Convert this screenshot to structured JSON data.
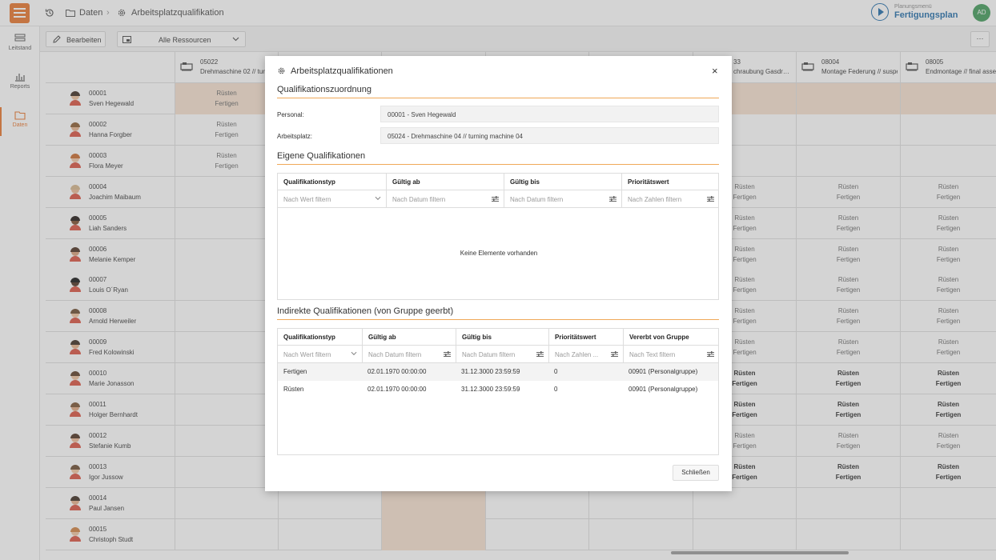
{
  "breadcrumb": {
    "items": [
      "Daten",
      "Arbeitsplatzqualifikation"
    ]
  },
  "planning": {
    "top_label": "Planungsmenü",
    "title": "Fertigungsplan"
  },
  "user": {
    "initials": "AD"
  },
  "sidebar": {
    "items": [
      {
        "label": "Leitstand"
      },
      {
        "label": "Reports"
      },
      {
        "label": "Daten"
      }
    ]
  },
  "toolbar": {
    "edit_label": "Bearbeiten",
    "resource_select": "Alle Ressourcen",
    "more": "···"
  },
  "columns": [
    {
      "id": "05022",
      "desc": "Drehmaschine 02 // turning machine 02"
    },
    {
      "id": "",
      "desc": ""
    },
    {
      "id": "",
      "desc": ""
    },
    {
      "id": "",
      "desc": ""
    },
    {
      "id": "",
      "desc": ""
    },
    {
      "id": "33",
      "desc": "chraubung Gasdr…"
    },
    {
      "id": "08004",
      "desc": "Montage Federung // suspension"
    },
    {
      "id": "08005",
      "desc": "Endmontage // final assembly"
    }
  ],
  "people": [
    {
      "id": "00001",
      "name": "Sven Hegewald"
    },
    {
      "id": "00002",
      "name": "Hanna Forgber"
    },
    {
      "id": "00003",
      "name": "Flora Meyer"
    },
    {
      "id": "00004",
      "name": "Joachim Maibaum"
    },
    {
      "id": "00005",
      "name": "Liah Sanders"
    },
    {
      "id": "00006",
      "name": "Melanie Kemper"
    },
    {
      "id": "00007",
      "name": "Louis O´Ryan"
    },
    {
      "id": "00008",
      "name": "Arnold Herweiler"
    },
    {
      "id": "00009",
      "name": "Fred Kolowinski"
    },
    {
      "id": "00010",
      "name": "Marie Jonasson"
    },
    {
      "id": "00011",
      "name": "Holger Bernhardt"
    },
    {
      "id": "00012",
      "name": "Stefanie Kumb"
    },
    {
      "id": "00013",
      "name": "Igor Jussow"
    },
    {
      "id": "00014",
      "name": "Paul Jansen"
    },
    {
      "id": "00015",
      "name": "Christoph Studt"
    }
  ],
  "cell_text": {
    "line1": "Rüsten",
    "line2": "Fertigen"
  },
  "modal": {
    "title": "Arbeitsplatzqualifikationen",
    "close_icon": "×",
    "section1": "Qualifikationszuordnung",
    "personal_label": "Personal:",
    "personal_value": "00001 - Sven Hegewald",
    "workplace_label": "Arbeitsplatz:",
    "workplace_value": "05024 - Drehmaschine 04 // turning machine 04",
    "section2": "Eigene Qualifikationen",
    "own_table": {
      "headers": [
        "Qualifikationstyp",
        "Gültig ab",
        "Gültig bis",
        "Prioritätswert"
      ],
      "filters": [
        "Nach Wert filtern",
        "Nach Datum filtern",
        "Nach Datum filtern",
        "Nach Zahlen filtern"
      ],
      "empty": "Keine Elemente vorhanden"
    },
    "section3": "Indirekte Qualifikationen (von Gruppe geerbt)",
    "ind_table": {
      "headers": [
        "Qualifikationstyp",
        "Gültig ab",
        "Gültig bis",
        "Prioritätswert",
        "Vererbt von Gruppe"
      ],
      "filters": [
        "Nach Wert filtern",
        "Nach Datum filtern",
        "Nach Datum filtern",
        "Nach Zahlen ...",
        "Nach Text filtern"
      ],
      "rows": [
        [
          "Fertigen",
          "02.01.1970 00:00:00",
          "31.12.3000 23:59:59",
          "0",
          "00901 (Personalgruppe)"
        ],
        [
          "Rüsten",
          "02.01.1970 00:00:00",
          "31.12.3000 23:59:59",
          "0",
          "00901 (Personalgruppe)"
        ]
      ]
    },
    "close_label": "Schließen"
  }
}
